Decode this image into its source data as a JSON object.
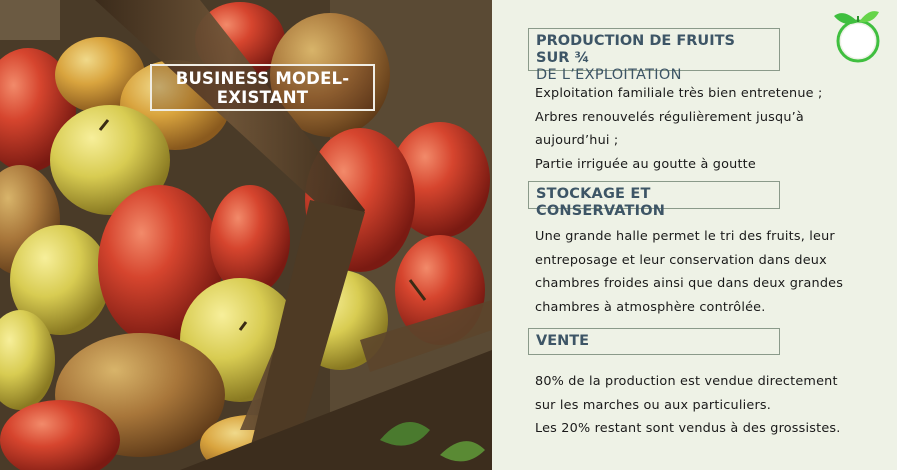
{
  "slide": {
    "title": "BUSINESS MODEL-EXISTANT",
    "colors": {
      "background": "#eef2e6",
      "heading_text": "#3d5566",
      "heading_border": "#8a9a8a",
      "body_text": "#1a1a1a",
      "logo_green": "#3fbf3f"
    },
    "logo_icon": "fruit-leaf-circle-icon",
    "photo": "basket-of-apples-and-pears"
  },
  "sections": [
    {
      "heading_line1": "PRODUCTION DE FRUITS SUR ¾",
      "heading_line2": "DE L’EXPLOITATION",
      "lines": [
        "Exploitation familiale très bien entretenue ;",
        "Arbres renouvelés régulièrement jusqu’à",
        "aujourd’hui ;",
        "Partie irriguée au goutte à goutte"
      ]
    },
    {
      "heading": "STOCKAGE ET CONSERVATION",
      "lines": [
        "Une grande halle permet le tri des fruits, leur",
        "entreposage et leur conservation dans deux",
        "chambres froides ainsi que dans deux grandes",
        "chambres à atmosphère contrôlée."
      ]
    },
    {
      "heading": "VENTE",
      "lines": [
        "80% de la production est vendue directement",
        "sur les marches ou aux particuliers.",
        "Les 20% restant sont vendus à des grossistes."
      ]
    }
  ]
}
